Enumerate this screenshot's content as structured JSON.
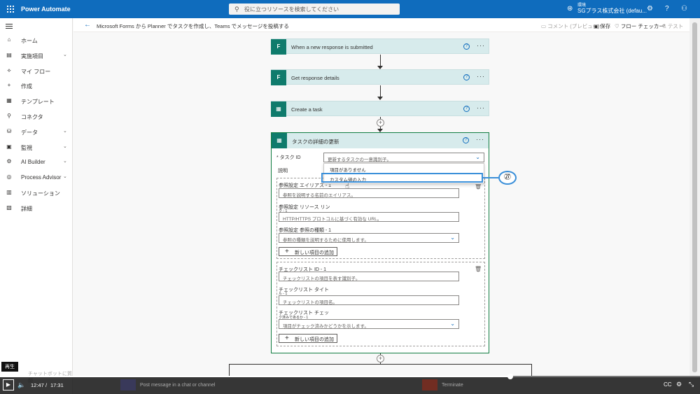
{
  "topbar": {
    "app_title": "Power Automate",
    "search_placeholder": "役に立つリソースを検索してください",
    "env_label": "環境",
    "env_name": "SGプラス株式会社 (defau..."
  },
  "sidebar": {
    "items": [
      {
        "label": "ホーム",
        "icon": "home-icon",
        "glyph": "⌂",
        "chevron": false
      },
      {
        "label": "実施項目",
        "icon": "clipboard-icon",
        "glyph": "▤",
        "chevron": true
      },
      {
        "label": "マイ フロー",
        "icon": "flow-icon",
        "glyph": "⟡",
        "chevron": false
      },
      {
        "label": "作成",
        "icon": "plus-icon",
        "glyph": "+",
        "chevron": false
      },
      {
        "label": "テンプレート",
        "icon": "template-icon",
        "glyph": "▦",
        "chevron": false
      },
      {
        "label": "コネクタ",
        "icon": "connector-icon",
        "glyph": "⚲",
        "chevron": false
      },
      {
        "label": "データ",
        "icon": "database-icon",
        "glyph": "⛁",
        "chevron": true
      },
      {
        "label": "監視",
        "icon": "monitor-icon",
        "glyph": "▣",
        "chevron": true
      },
      {
        "label": "AI Builder",
        "icon": "ai-builder-icon",
        "glyph": "⚙",
        "chevron": true
      },
      {
        "label": "Process Advisor",
        "icon": "process-advisor-icon",
        "glyph": "◎",
        "chevron": true
      },
      {
        "label": "ソリューション",
        "icon": "solution-icon",
        "glyph": "▥",
        "chevron": false
      },
      {
        "label": "詳細",
        "icon": "book-icon",
        "glyph": "▧",
        "chevron": false
      }
    ],
    "chatbot": "チャットボットに質問"
  },
  "subbar": {
    "breadcrumb": "Microsoft Forms から Planner でタスクを作成し、Teams でメッセージを投稿する",
    "comment": "コメント (プレビュー)",
    "save": "保存",
    "checker": "フロー チェッカー",
    "test": "テスト"
  },
  "flow": {
    "steps": [
      {
        "title": "When a new response is submitted",
        "icon": "forms-icon",
        "glyph": "F"
      },
      {
        "title": "Get response details",
        "icon": "forms-icon",
        "glyph": "F"
      },
      {
        "title": "Create a task",
        "icon": "planner-icon",
        "glyph": "▦"
      }
    ],
    "action": {
      "title": "タスクの詳細の更新",
      "task_id_label": "* タスク ID",
      "task_id_placeholder": "更新するタスクの一意識別子。",
      "description_label": "説明",
      "dropdown_options": [
        "項目がありません",
        "カスタム値の入力"
      ],
      "references": {
        "alias_label": "参照設定 エイリアス - 1",
        "alias_placeholder": "参照を説明する名前のエイリアス。",
        "resource_label": "参照設定 リソース リン",
        "resource_label2": "ク - 1",
        "resource_placeholder": "HTTP/HTTPS プロトコルに基づく有効な URL。",
        "type_label": "参照設定 参照の種類 - 1",
        "type_placeholder": "参照の種類を説明するために使用します。",
        "add_label": "新しい項目の追加"
      },
      "checklist": {
        "id_label": "チェックリスト ID - 1",
        "id_placeholder": "チェックリストの項目を表す識別子。",
        "title_label": "チェックリスト タイト",
        "title_label2": "ル - 1",
        "title_placeholder": "チェックリストの項目名。",
        "checked_label": "チェックリスト チェッ",
        "checked_label2": "ク済みであるか - 1",
        "checked_placeholder": "項目がチェック済みかどうかを示します。",
        "add_label": "新しい項目の追加"
      }
    },
    "annotation": "㉗",
    "bottom_steps": [
      "Post message in a chat or channel",
      "Terminate"
    ]
  },
  "player": {
    "tooltip": "再生",
    "time_current": "12:47",
    "time_sep": "/",
    "time_total": "17:31",
    "progress_fraction": 0.729
  }
}
